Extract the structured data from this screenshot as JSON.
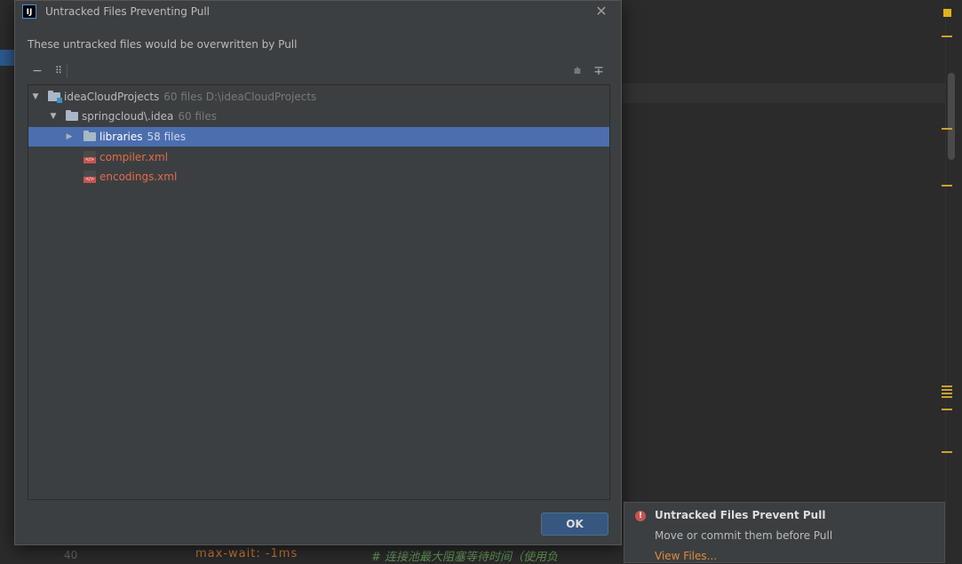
{
  "dialog": {
    "title": "Untracked Files Preventing Pull",
    "app_icon_text": "IJ",
    "close_glyph": "✕",
    "message": "These untracked files would be overwritten by Pull",
    "toolbar": {
      "remove_glyph": "−",
      "group_glyph": "⠿",
      "expand_all_glyph": "⩧",
      "collapse_all_glyph": "∓"
    },
    "tree": [
      {
        "name": "ideaCloudProjects",
        "meta": "60 files  D:\\ideaCloudProjects",
        "icon": "project-folder-icon",
        "expanded": true
      },
      {
        "name": "springcloud\\.idea",
        "meta": "60 files",
        "icon": "folder-icon",
        "expanded": true
      },
      {
        "name": "libraries",
        "meta": "58 files",
        "icon": "folder-icon",
        "expanded": false,
        "selected": true
      },
      {
        "name": "compiler.xml",
        "meta": "",
        "icon": "xml-file-icon",
        "color": "#e06c4c"
      },
      {
        "name": "encodings.xml",
        "meta": "",
        "icon": "xml-file-icon",
        "color": "#e06c4c"
      }
    ],
    "ok_label": "OK"
  },
  "notification": {
    "title": "Untracked Files Prevent Pull",
    "body": "Move or commit them before Pull",
    "link": "View Files..."
  },
  "editor": {
    "line_number": "40",
    "code": "max-wait: -1ms",
    "comment": "# 连接池最大阻塞等待时间（使用负"
  },
  "colors": {
    "accent": "#4b6eaf",
    "error": "#c75450",
    "untracked_text": "#e06c4c",
    "link": "#e08a3c",
    "marker": "#c9a22a"
  }
}
